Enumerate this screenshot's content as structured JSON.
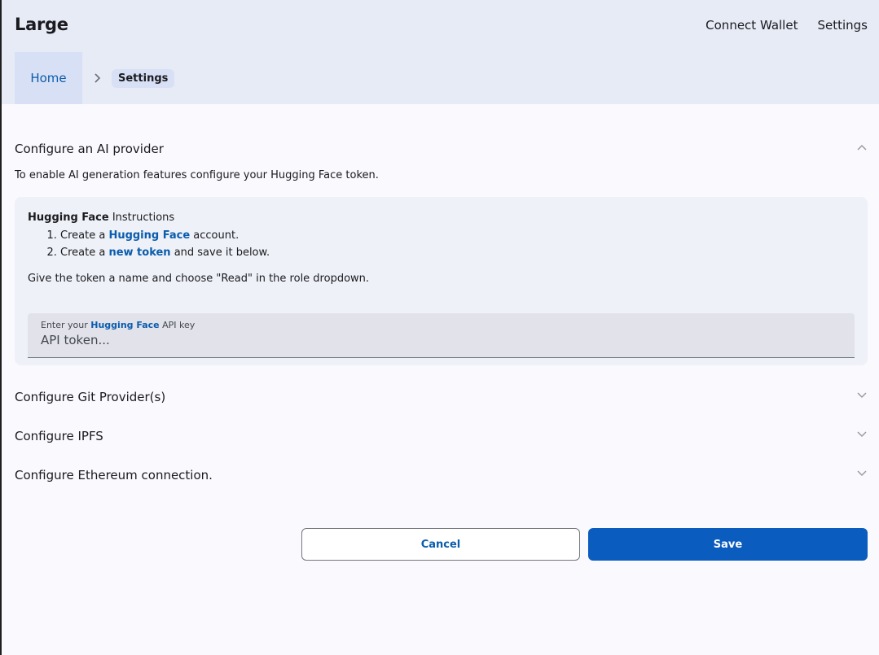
{
  "app": {
    "title": "Large"
  },
  "nav": {
    "connect_wallet": "Connect Wallet",
    "settings": "Settings"
  },
  "breadcrumb": {
    "home": "Home",
    "current": "Settings"
  },
  "ai_provider": {
    "title": "Configure an AI provider",
    "description": "To enable AI generation features configure your Hugging Face token.",
    "instructions": {
      "brand": "Hugging Face",
      "heading_suffix": " Instructions",
      "step1_prefix": "Create a ",
      "step1_link": "Hugging Face",
      "step1_suffix": " account.",
      "step2_prefix": "Create a ",
      "step2_link": "new token",
      "step2_suffix": " and save it below.",
      "note": "Give the token a name and choose \"Read\" in the role dropdown."
    },
    "field": {
      "label_prefix": "Enter your ",
      "label_link": "Hugging Face",
      "label_suffix": " API key",
      "value": "",
      "placeholder": "API token..."
    }
  },
  "sections": {
    "git": "Configure Git Provider(s)",
    "ipfs": "Configure IPFS",
    "ethereum": "Configure Ethereum connection."
  },
  "actions": {
    "cancel": "Cancel",
    "save": "Save"
  },
  "icons": {
    "expand": "chevron-down-icon",
    "collapse": "chevron-up-icon",
    "separator": "chevron-right-icon"
  },
  "colors": {
    "accent": "#0b5cbf",
    "link": "#0b5cad",
    "header_bg": "#e7ebf6"
  }
}
